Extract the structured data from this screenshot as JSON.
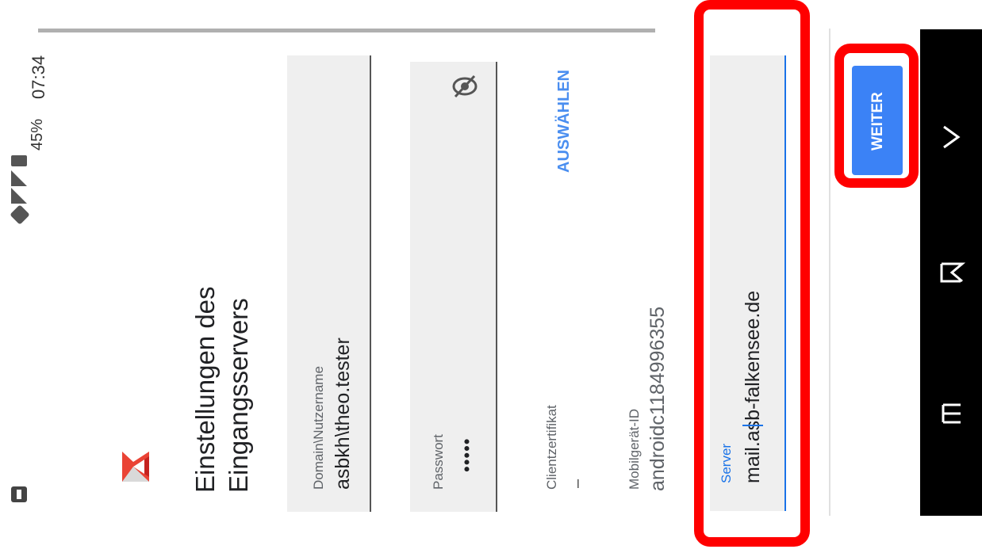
{
  "status": {
    "time": "07:34",
    "battery": "45%"
  },
  "screen": {
    "title_line1": "Einstellungen des",
    "title_line2": "Eingangsservers"
  },
  "fields": {
    "domain": {
      "label": "Domain\\Nutzername",
      "value": "asbkh\\theo.tester"
    },
    "password": {
      "label": "Passwort",
      "value": "•••••"
    },
    "client_cert": {
      "label": "Clientzertifikat",
      "value": "–",
      "action": "AUSWÄHLEN"
    },
    "mobile_id": {
      "label": "Mobilgerät-ID",
      "value": "androidc1184996355"
    },
    "server": {
      "label": "Server",
      "value": "mail.asb-falkensee.de"
    }
  },
  "buttons": {
    "next": "WEITER"
  },
  "icons": {
    "gmail": "gmail-logo-icon",
    "password_toggle": "eye-off-icon",
    "nav_down": "chevron-down-icon",
    "nav_back": "back-icon",
    "nav_recent": "recent-apps-icon"
  },
  "colors": {
    "accent": "#1a73e8",
    "button": "#3b82f6",
    "highlight": "#ff0000"
  }
}
